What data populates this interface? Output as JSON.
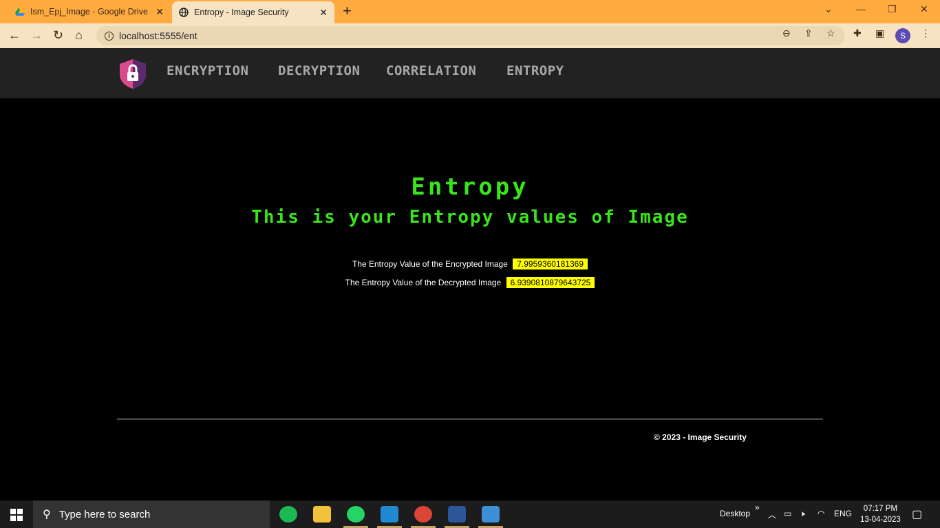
{
  "browser": {
    "tabs": [
      {
        "title": "Ism_Epj_Image - Google Drive",
        "active": false
      },
      {
        "title": "Entropy - Image Security",
        "active": true
      }
    ],
    "url": "localhost:5555/ent",
    "profile_initial": "S"
  },
  "site": {
    "nav": [
      "ENCRYPTION",
      "DECRYPTION",
      "CORRELATION",
      "ENTROPY"
    ],
    "title": "Entropy",
    "subtitle": "This is your Entropy values of Image",
    "rows": [
      {
        "label": "The Entropy Value of the Encrypted Image",
        "value": "7.9959360181369"
      },
      {
        "label": "The Entropy Value of the Decrypted Image",
        "value": "6.9390810879643725"
      }
    ],
    "footer": "© 2023 - Image Security"
  },
  "taskbar": {
    "search_placeholder": "Type here to search",
    "desktop_label": "Desktop",
    "lang": "ENG",
    "time": "07:17 PM",
    "date": "13-04-2023"
  },
  "colors": {
    "accent_green": "#39e51a",
    "highlight": "#ffff00",
    "chrome": "#ffab40"
  }
}
